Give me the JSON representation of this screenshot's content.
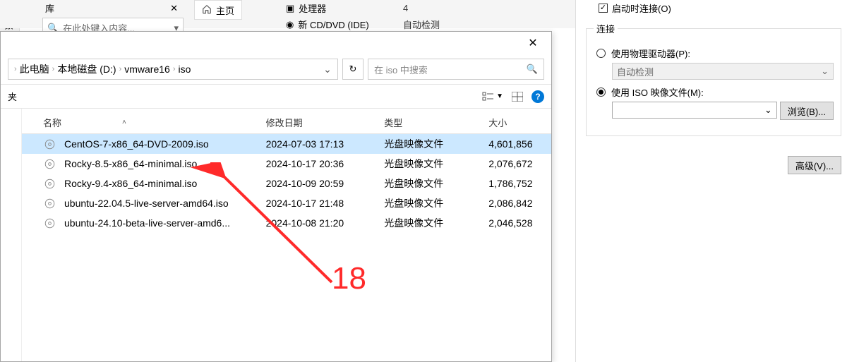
{
  "bg": {
    "library_label": "库",
    "search_placeholder": "在此处键入内容...",
    "vert_label": "数据",
    "home_tab": "主页",
    "hw_cpu_label": "处理器",
    "hw_cpu_val": "4",
    "hw_cd_label": "新 CD/DVD (IDE)",
    "hw_cd_val": "自动检测"
  },
  "settings": {
    "connect_at_power_on": "启动时连接(O)",
    "group_title": "连接",
    "use_physical": "使用物理驱动器(P):",
    "physical_val": "自动检测",
    "use_iso": "使用 ISO 映像文件(M):",
    "browse": "浏览(B)...",
    "advanced": "高级(V)..."
  },
  "dialog": {
    "breadcrumb": [
      "此电脑",
      "本地磁盘 (D:)",
      "vmware16",
      "iso"
    ],
    "search_placeholder": "在 iso 中搜索",
    "organize_label": "夹",
    "columns": {
      "name": "名称",
      "date": "修改日期",
      "type": "类型",
      "size": "大小"
    },
    "files": [
      {
        "name": "CentOS-7-x86_64-DVD-2009.iso",
        "date": "2024-07-03 17:13",
        "type": "光盘映像文件",
        "size": "4,601,856",
        "selected": true
      },
      {
        "name": "Rocky-8.5-x86_64-minimal.iso",
        "date": "2024-10-17 20:36",
        "type": "光盘映像文件",
        "size": "2,076,672",
        "selected": false
      },
      {
        "name": "Rocky-9.4-x86_64-minimal.iso",
        "date": "2024-10-09 20:59",
        "type": "光盘映像文件",
        "size": "1,786,752",
        "selected": false
      },
      {
        "name": "ubuntu-22.04.5-live-server-amd64.iso",
        "date": "2024-10-17 21:48",
        "type": "光盘映像文件",
        "size": "2,086,842",
        "selected": false
      },
      {
        "name": "ubuntu-24.10-beta-live-server-amd6...",
        "date": "2024-10-08 21:20",
        "type": "光盘映像文件",
        "size": "2,046,528",
        "selected": false
      }
    ]
  },
  "annotation": {
    "number": "18"
  }
}
